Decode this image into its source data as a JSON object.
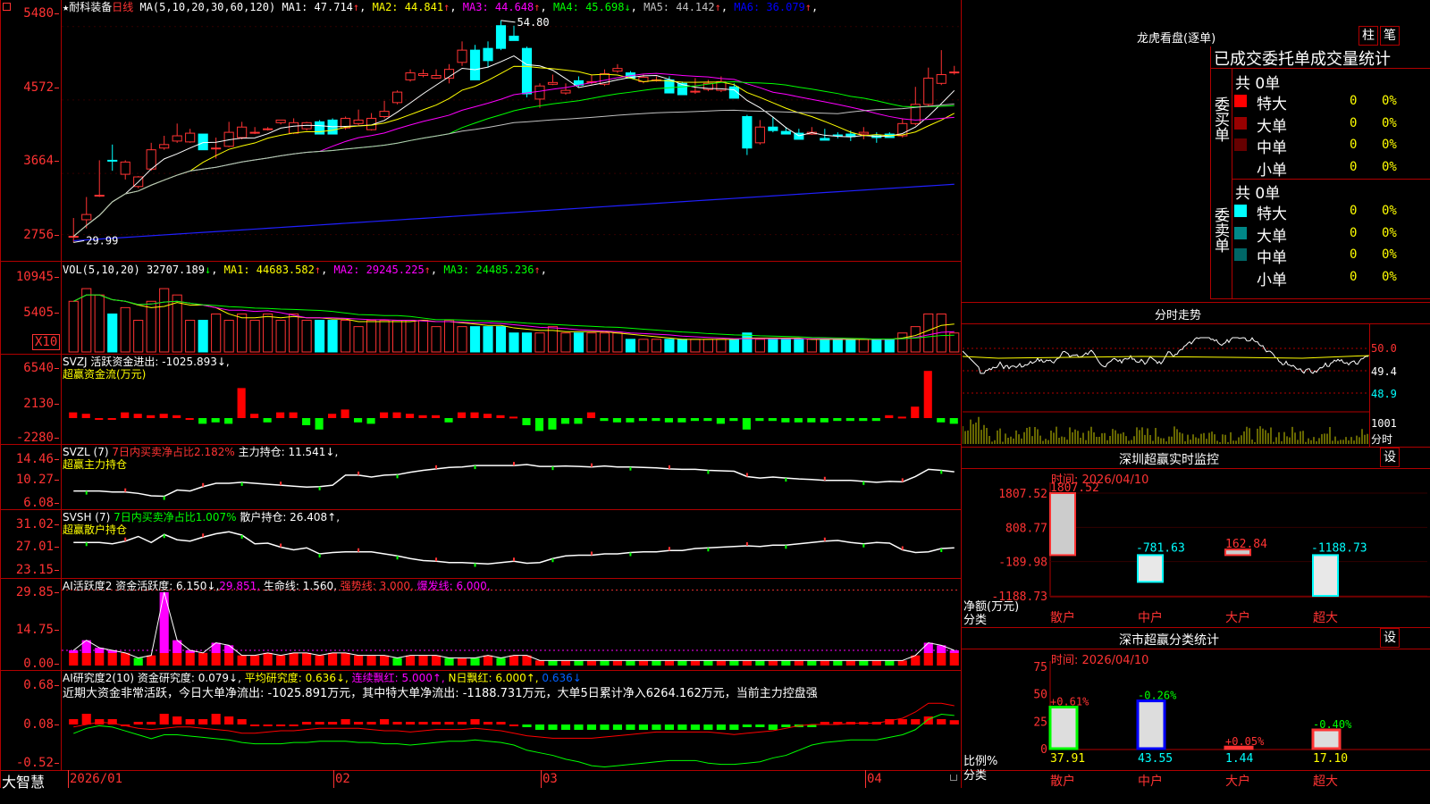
{
  "top_icon": "square-icon",
  "main": {
    "stock": "★耐科装备",
    "period": "日线",
    "ma_label": "MA(5,10,20,30,60,120)",
    "ma_vals": [
      {
        "name": "MA1:",
        "val": "47.714",
        "arr": "↑",
        "color": "#ffffff"
      },
      {
        "name": "MA2:",
        "val": "44.841",
        "arr": "↑",
        "color": "#ffff00"
      },
      {
        "name": "MA3:",
        "val": "44.648",
        "arr": "↑",
        "color": "#ff00ff"
      },
      {
        "name": "MA4:",
        "val": "45.698",
        "arr": "↓",
        "color": "#00ff00"
      },
      {
        "name": "MA5:",
        "val": "44.142",
        "arr": "↑",
        "color": "#c0c0c0"
      },
      {
        "name": "MA6:",
        "val": "36.079",
        "arr": "↑",
        "color": "#0000ff"
      }
    ],
    "y_ticks": [
      "5480",
      "4572",
      "3664",
      "2756"
    ],
    "max_label": "54.80",
    "min_label": "29.99"
  },
  "vol": {
    "label": "VOL(5,10,20)",
    "value": "32707.189",
    "val_arr": "↓",
    "ma": [
      {
        "name": "MA1:",
        "val": "44683.582",
        "arr": "↑",
        "color": "#ffff00"
      },
      {
        "name": "MA2:",
        "val": "29245.225",
        "arr": "↑",
        "color": "#ff00ff"
      },
      {
        "name": "MA3:",
        "val": "24485.236",
        "arr": "↑",
        "color": "#00ff00"
      }
    ],
    "y_ticks": [
      "10945",
      "5405"
    ],
    "x10": "X10"
  },
  "svzj": {
    "l1": "SVZJ  活跃资金进出: -1025.893↓,",
    "l2": "超赢资金流(万元)",
    "y_ticks": [
      "6540",
      "2130",
      "-2280"
    ]
  },
  "svzl": {
    "l1a": "SVZL (7) ",
    "l1b": "7日内买卖净占比2.182%",
    "l1c": " 主力持仓: 11.541↓,",
    "l2": "超赢主力持仓",
    "y_ticks": [
      "14.46",
      "10.27",
      "6.08"
    ]
  },
  "svsh": {
    "l1a": "SVSH (7) ",
    "l1b": "7日内买卖净占比1.007%",
    "l1c": " 散户持仓: 26.408↑,",
    "l2": "超赢散户持仓",
    "y_ticks": [
      "31.02",
      "27.01",
      "23.15"
    ]
  },
  "ai_act": {
    "a": "AI活跃度2 资金活跃度: 6.150↓,",
    "b": "29.851,",
    "c": " 生命线: 1.560,",
    "d": " 强势线: 3.000,",
    "e": " 爆发线: 6.000,",
    "y_ticks": [
      "29.85",
      "14.75",
      "0.00"
    ]
  },
  "ai_res": {
    "a": "AI研究度2(10) 资金研究度: 0.079↓,",
    "b": " 平均研究度: 0.636↓,",
    "c": " 连续飘红: 5.000↑,",
    "d": " N日飘红: 6.000↑,",
    "e": " 0.636↓",
    "desc": "近期大资金非常活跃，今日大单净流出: -1025.891万元，其中特大单净流出: -1188.731万元，大单5日累计净入6264.162万元，当前主力控盘强",
    "y_ticks": [
      "0.68",
      "0.08",
      "-0.52"
    ]
  },
  "xaxis": {
    "brand": "大智慧",
    "labels": [
      "2026/01",
      "02",
      "03",
      "04"
    ]
  },
  "dragon": {
    "title": "龙虎看盘(逐单)",
    "btn1": "柱",
    "btn2": "笔",
    "subtitle": "已成交委托单成交量统计",
    "buy_title": "委买单",
    "buy_total": "共 0单",
    "sell_title": "委卖单",
    "sell_total": "共 0单",
    "buy_rows": [
      {
        "label": "特大",
        "count": "0",
        "pct": "0%",
        "color": "#ff0000"
      },
      {
        "label": "大单",
        "count": "0",
        "pct": "0%",
        "color": "#990000"
      },
      {
        "label": "中单",
        "count": "0",
        "pct": "0%",
        "color": "#660000"
      },
      {
        "label": "小单",
        "count": "0",
        "pct": "0%",
        "color": "#000000"
      }
    ],
    "sell_rows": [
      {
        "label": "特大",
        "count": "0",
        "pct": "0%",
        "color": "#00ffff"
      },
      {
        "label": "大单",
        "count": "0",
        "pct": "0%",
        "color": "#008888"
      },
      {
        "label": "中单",
        "count": "0",
        "pct": "0%",
        "color": "#006666"
      },
      {
        "label": "小单",
        "count": "0",
        "pct": "0%",
        "color": "#000000"
      }
    ]
  },
  "intraday": {
    "title": "分时走势",
    "p1": "50.0",
    "p2": "49.4",
    "p3": "48.9",
    "vol": "1001",
    "label": "分时"
  },
  "monitor": {
    "title": "深圳超赢实时监控",
    "btn": "设",
    "time": "时间: 2026/04/10",
    "y_ticks": [
      "1807.52",
      "808.77",
      "-189.98",
      "-1188.73"
    ],
    "axis_label_1": "净额(万元)",
    "axis_label_2": "分类",
    "cats": [
      "散户",
      "中户",
      "大户",
      "超大"
    ],
    "values": [
      1807.52,
      -781.63,
      162.84,
      -1188.73
    ],
    "value_labels": [
      "1807.52",
      "-781.63",
      "162.84",
      "-1188.73"
    ]
  },
  "cls": {
    "title": "深市超赢分类统计",
    "btn": "设",
    "time": "时间: 2026/04/10",
    "y_ticks": [
      "75",
      "50",
      "25",
      "0"
    ],
    "axis_label_1": "比例%",
    "axis_label_2": "分类",
    "cats": [
      "散户",
      "中户",
      "大户",
      "超大"
    ],
    "values": [
      37.91,
      43.55,
      1.44,
      17.1
    ],
    "value_labels": [
      "37.91",
      "43.55",
      "1.44",
      "17.10"
    ],
    "changes": [
      "+0.61%",
      "-0.26%",
      "+0.05%",
      "-0.40%"
    ],
    "change_colors": [
      "#ff3333",
      "#00ff00",
      "#ff3333",
      "#00ff00"
    ],
    "bar_colors": [
      "#00ff00",
      "#0000ff",
      "#ff3333",
      "#ff3333"
    ],
    "label_colors": [
      "#ffff00",
      "#00ffff",
      "#00ffff",
      "#ffff00"
    ]
  },
  "chart_data": {
    "type": "candlestick",
    "title": "耐科装备 日线",
    "y_range": [
      27.5,
      55.5
    ],
    "note": "values approximated visually",
    "candles": [
      [
        30.0,
        29.4,
        30.1,
        32.2
      ],
      [
        32.0,
        31.0,
        32.6,
        34.6
      ],
      [
        34.8,
        34.6,
        34.8,
        38.8
      ],
      [
        38.8,
        37.6,
        38.7,
        40.6
      ],
      [
        37.2,
        36.6,
        38.6,
        38.8
      ],
      [
        35.8,
        35.6,
        36.9,
        37.0
      ],
      [
        37.8,
        37.6,
        40.0,
        40.8
      ],
      [
        40.2,
        40.0,
        40.6,
        41.6
      ],
      [
        41.0,
        40.8,
        41.6,
        43.0
      ],
      [
        40.9,
        40.8,
        41.9,
        42.4
      ],
      [
        41.8,
        40.6,
        40.0,
        41.8
      ],
      [
        40.2,
        39.0,
        40.2,
        41.4
      ],
      [
        40.4,
        40.3,
        42.0,
        43.2
      ],
      [
        41.4,
        41.2,
        42.6,
        43.2
      ],
      [
        42.0,
        41.8,
        42.0,
        42.6
      ],
      [
        42.3,
        42.2,
        42.4,
        42.6
      ],
      [
        43.1,
        42.9,
        43.4,
        43.4
      ],
      [
        41.9,
        41.8,
        43.1,
        43.6
      ],
      [
        42.4,
        42.2,
        43.1,
        43.2
      ],
      [
        43.2,
        43.2,
        41.8,
        43.4
      ],
      [
        43.4,
        42.4,
        41.8,
        43.6
      ],
      [
        42.5,
        42.3,
        43.6,
        43.8
      ],
      [
        43.0,
        42.8,
        43.4,
        44.6
      ],
      [
        42.3,
        42.2,
        43.6,
        44.2
      ],
      [
        43.8,
        43.6,
        44.4,
        45.6
      ],
      [
        45.4,
        45.2,
        46.6,
        46.8
      ],
      [
        48.0,
        47.8,
        48.8,
        49.2
      ],
      [
        48.5,
        48.3,
        48.7,
        49.2
      ],
      [
        48.2,
        48.1,
        48.5,
        49.2
      ],
      [
        48.2,
        47.6,
        49.2,
        49.8
      ],
      [
        50.0,
        49.6,
        51.4,
        52.4
      ],
      [
        51.4,
        49.8,
        48.0,
        52.0
      ],
      [
        51.6,
        49.4,
        50.2,
        52.4
      ],
      [
        54.2,
        51.4,
        51.6,
        54.8
      ],
      [
        53.0,
        52.9,
        52.5,
        54.2
      ],
      [
        51.6,
        46.0,
        46.4,
        51.8
      ],
      [
        45.8,
        44.8,
        47.3,
        47.6
      ],
      [
        47.5,
        47.4,
        47.7,
        48.6
      ],
      [
        46.5,
        46.3,
        46.8,
        47.6
      ],
      [
        47.9,
        47.2,
        47.4,
        48.4
      ],
      [
        47.7,
        47.5,
        47.8,
        48.6
      ],
      [
        47.5,
        47.3,
        48.7,
        49.2
      ],
      [
        49.0,
        48.8,
        49.3,
        49.8
      ],
      [
        48.8,
        48.4,
        48.2,
        49.0
      ],
      [
        47.8,
        47.6,
        48.3,
        48.6
      ],
      [
        48.0,
        47.8,
        48.0,
        48.4
      ],
      [
        48.0,
        47.8,
        46.5,
        48.4
      ],
      [
        47.6,
        47.4,
        46.3,
        47.8
      ],
      [
        46.6,
        46.4,
        46.7,
        48.2
      ],
      [
        46.9,
        46.7,
        47.6,
        48.0
      ],
      [
        46.8,
        46.6,
        47.8,
        48.4
      ],
      [
        47.2,
        46.8,
        45.9,
        47.6
      ],
      [
        43.8,
        39.4,
        40.2,
        44.0
      ],
      [
        40.8,
        40.6,
        42.6,
        43.4
      ],
      [
        42.6,
        42.0,
        42.2,
        43.8
      ],
      [
        42.1,
        41.8,
        41.8,
        42.6
      ],
      [
        41.9,
        41.3,
        41.2,
        42.4
      ],
      [
        41.8,
        41.7,
        42.0,
        42.6
      ],
      [
        41.3,
        41.2,
        41.1,
        42.4
      ],
      [
        41.7,
        41.3,
        41.6,
        42.0
      ],
      [
        41.8,
        41.0,
        41.5,
        42.2
      ],
      [
        41.8,
        41.2,
        42.0,
        42.6
      ],
      [
        41.6,
        40.8,
        41.4,
        42.0
      ],
      [
        41.8,
        41.6,
        41.4,
        42.0
      ],
      [
        41.6,
        41.4,
        43.0,
        43.6
      ],
      [
        43.0,
        42.8,
        45.2,
        47.2
      ],
      [
        45.2,
        45.0,
        48.2,
        49.4
      ],
      [
        47.6,
        47.4,
        48.6,
        51.4
      ],
      [
        48.8,
        48.6,
        48.9,
        49.6
      ]
    ]
  }
}
